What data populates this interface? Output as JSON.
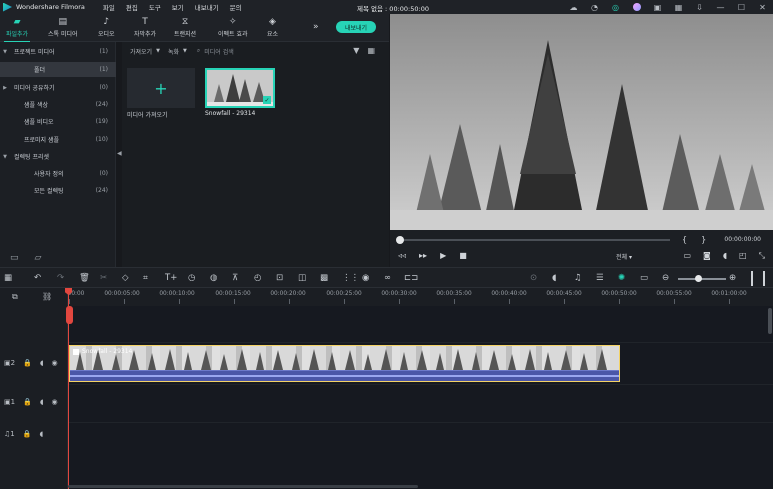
{
  "app": {
    "name": "Wondershare Filmora",
    "project_title": "제목 없음 : 00:00:50:00",
    "menu": [
      "파일",
      "편집",
      "도구",
      "보기",
      "내보내기",
      "문의"
    ],
    "title_icons": [
      "cloud-icon",
      "bell-icon",
      "support-icon",
      "avatar-icon",
      "save-icon",
      "grid-icon",
      "download-icon",
      "minimize-icon",
      "maximize-icon",
      "close-icon"
    ]
  },
  "toolbar": {
    "tools": [
      {
        "label": "파일추가",
        "icon": "folder-icon",
        "active": true
      },
      {
        "label": "스톡 미디어",
        "icon": "stock-media-icon",
        "active": false
      },
      {
        "label": "오디오",
        "icon": "music-icon",
        "active": false
      },
      {
        "label": "자막추가",
        "icon": "title-icon",
        "active": false
      },
      {
        "label": "트랜지션",
        "icon": "transition-icon",
        "active": false
      },
      {
        "label": "이펙트 효과",
        "icon": "effect-icon",
        "active": false
      },
      {
        "label": "요소",
        "icon": "element-icon",
        "active": false
      }
    ],
    "export_label": "내보내기",
    "accent": "#27d3b6"
  },
  "sidebar": {
    "items": [
      {
        "label": "프로젝트 미디어",
        "count": "(1)",
        "arrow": "▼",
        "indent": 0,
        "selected": false
      },
      {
        "label": "폴더",
        "count": "(1)",
        "arrow": "",
        "indent": 1,
        "selected": true
      },
      {
        "label": "미디어 공유하기",
        "count": "(0)",
        "arrow": "▶",
        "indent": 0,
        "selected": false
      },
      {
        "label": "샘플 색상",
        "count": "(24)",
        "arrow": "",
        "indent": 0,
        "selected": false
      },
      {
        "label": "샘플 비디오",
        "count": "(19)",
        "arrow": "",
        "indent": 0,
        "selected": false
      },
      {
        "label": "프로미지 샘플",
        "count": "(10)",
        "arrow": "",
        "indent": 0,
        "selected": false
      },
      {
        "label": "컬렉팅 프리셋",
        "count": "",
        "arrow": "▼",
        "indent": 0,
        "selected": false
      },
      {
        "label": "사용자 정의",
        "count": "(0)",
        "arrow": "",
        "indent": 1,
        "selected": false
      },
      {
        "label": "모든 컬렉팅",
        "count": "(24)",
        "arrow": "",
        "indent": 1,
        "selected": false
      }
    ]
  },
  "media": {
    "sort_label": "가져오기",
    "record_label": "녹화",
    "search_placeholder": "미디어 검색",
    "import_label": "미디어 가져오기",
    "items": [
      {
        "label": "Snowfall - 29314"
      }
    ]
  },
  "preview": {
    "timecode": "00:00:00:00",
    "quality_label": "전체"
  },
  "timeline": {
    "ruler_labels": [
      "00:00",
      "00:00:05:00",
      "00:00:10:00",
      "00:00:15:00",
      "00:00:20:00",
      "00:00:25:00",
      "00:00:30:00",
      "00:00:35:00",
      "00:00:40:00",
      "00:00:45:00",
      "00:00:50:00",
      "00:00:55:00",
      "00:01:00:00"
    ],
    "clip_label": "Snowfall - 29314",
    "tracks": [
      {
        "label": "2",
        "icon": "video-track-icon"
      },
      {
        "label": "1",
        "icon": "video-track-icon"
      },
      {
        "label": "1",
        "icon": "audio-track-icon"
      }
    ]
  }
}
